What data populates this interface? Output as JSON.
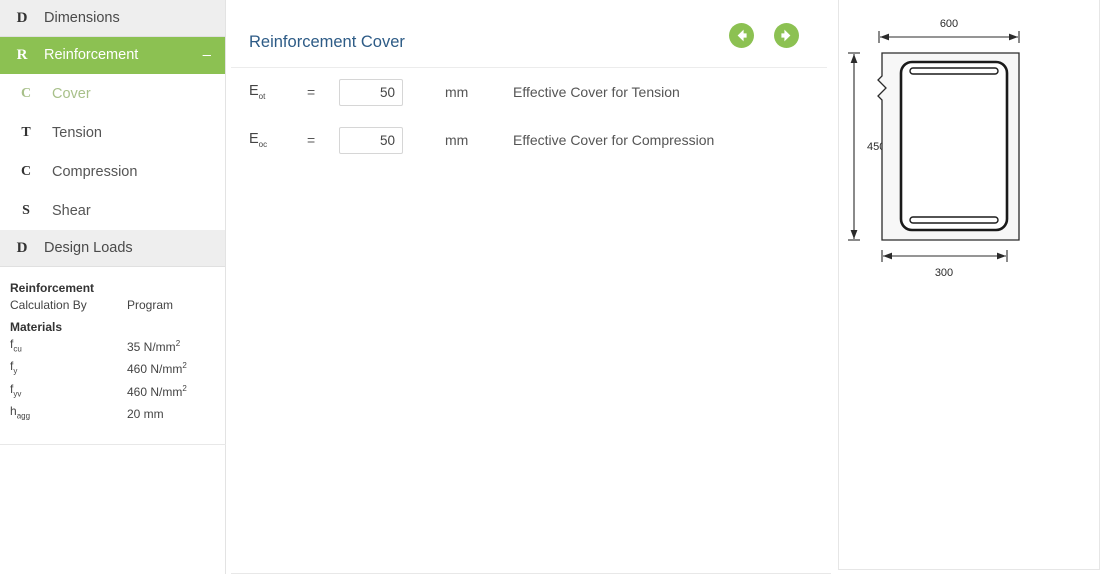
{
  "sidebar": {
    "groups": [
      {
        "icon_letter": "D",
        "icon_name": "dimensions-icon",
        "label": "Dimensions",
        "active": false,
        "toggle": ""
      },
      {
        "icon_letter": "R",
        "icon_name": "reinforcement-icon",
        "label": "Reinforcement",
        "active": true,
        "toggle": "–"
      },
      {
        "icon_letter": "D",
        "icon_name": "design-loads-icon",
        "label": "Design Loads",
        "active": false,
        "toggle": ""
      }
    ],
    "sub_items": [
      {
        "icon_letter": "C",
        "label": "Cover",
        "selected": true
      },
      {
        "icon_letter": "T",
        "label": "Tension",
        "selected": false
      },
      {
        "icon_letter": "C",
        "label": "Compression",
        "selected": false
      },
      {
        "icon_letter": "S",
        "label": "Shear",
        "selected": false
      }
    ]
  },
  "summary": {
    "title": "Reinforcement",
    "calculation_by_label": "Calculation By",
    "calculation_by_value": "Program",
    "materials_label": "Materials",
    "materials": [
      {
        "symbol": "f",
        "sub": "cu",
        "value": "35 N/mm",
        "sup": "2"
      },
      {
        "symbol": "f",
        "sub": "y",
        "value": "460 N/mm",
        "sup": "2"
      },
      {
        "symbol": "f",
        "sub": "yv",
        "value": "460 N/mm",
        "sup": "2"
      },
      {
        "symbol": "h",
        "sub": "agg",
        "value": "20 mm",
        "sup": ""
      }
    ]
  },
  "main": {
    "title": "Reinforcement Cover",
    "nav": {
      "back_label": "Back",
      "forward_label": "Forward"
    },
    "fields": [
      {
        "symbol": "E",
        "sub": "ot",
        "equals": "=",
        "value": "50",
        "placeholder": "",
        "unit": "mm",
        "description": "Effective Cover for Tension"
      },
      {
        "symbol": "E",
        "sub": "oc",
        "equals": "=",
        "value": "50",
        "placeholder": "",
        "unit": "mm",
        "description": "Effective Cover for Compression"
      }
    ]
  },
  "diagram": {
    "top_dimension": "600",
    "left_dimension": "450",
    "bottom_dimension": "300"
  },
  "colors": {
    "accent_green": "#8cc152",
    "title_blue": "#2d5b86",
    "muted_green": "#a8c08a",
    "panel_gray": "#eeeeee"
  }
}
